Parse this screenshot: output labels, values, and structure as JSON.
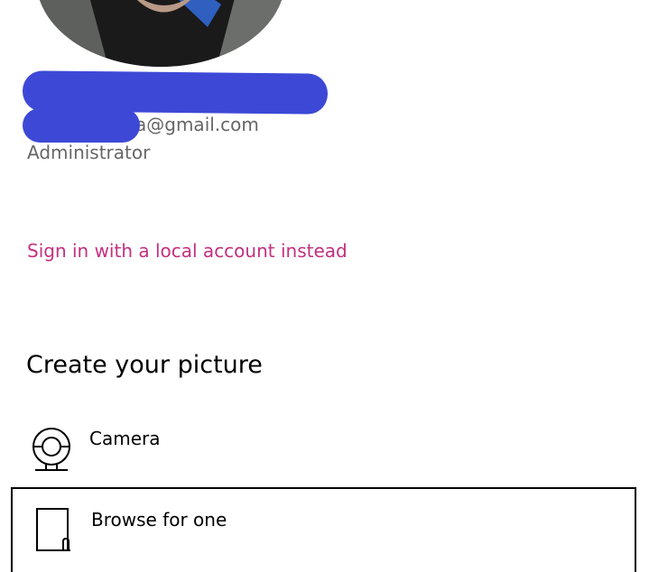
{
  "account": {
    "email_visible_suffix": "a@gmail.com",
    "role": "Administrator"
  },
  "links": {
    "local_account": "Sign in with a local account instead"
  },
  "create_picture": {
    "title": "Create your picture",
    "options": [
      {
        "label": "Camera",
        "icon": "camera-icon"
      },
      {
        "label": "Browse for one",
        "icon": "file-icon"
      }
    ]
  },
  "colors": {
    "link": "#c3307e",
    "secondary_text": "#666666",
    "redaction": "#3d49d6"
  }
}
